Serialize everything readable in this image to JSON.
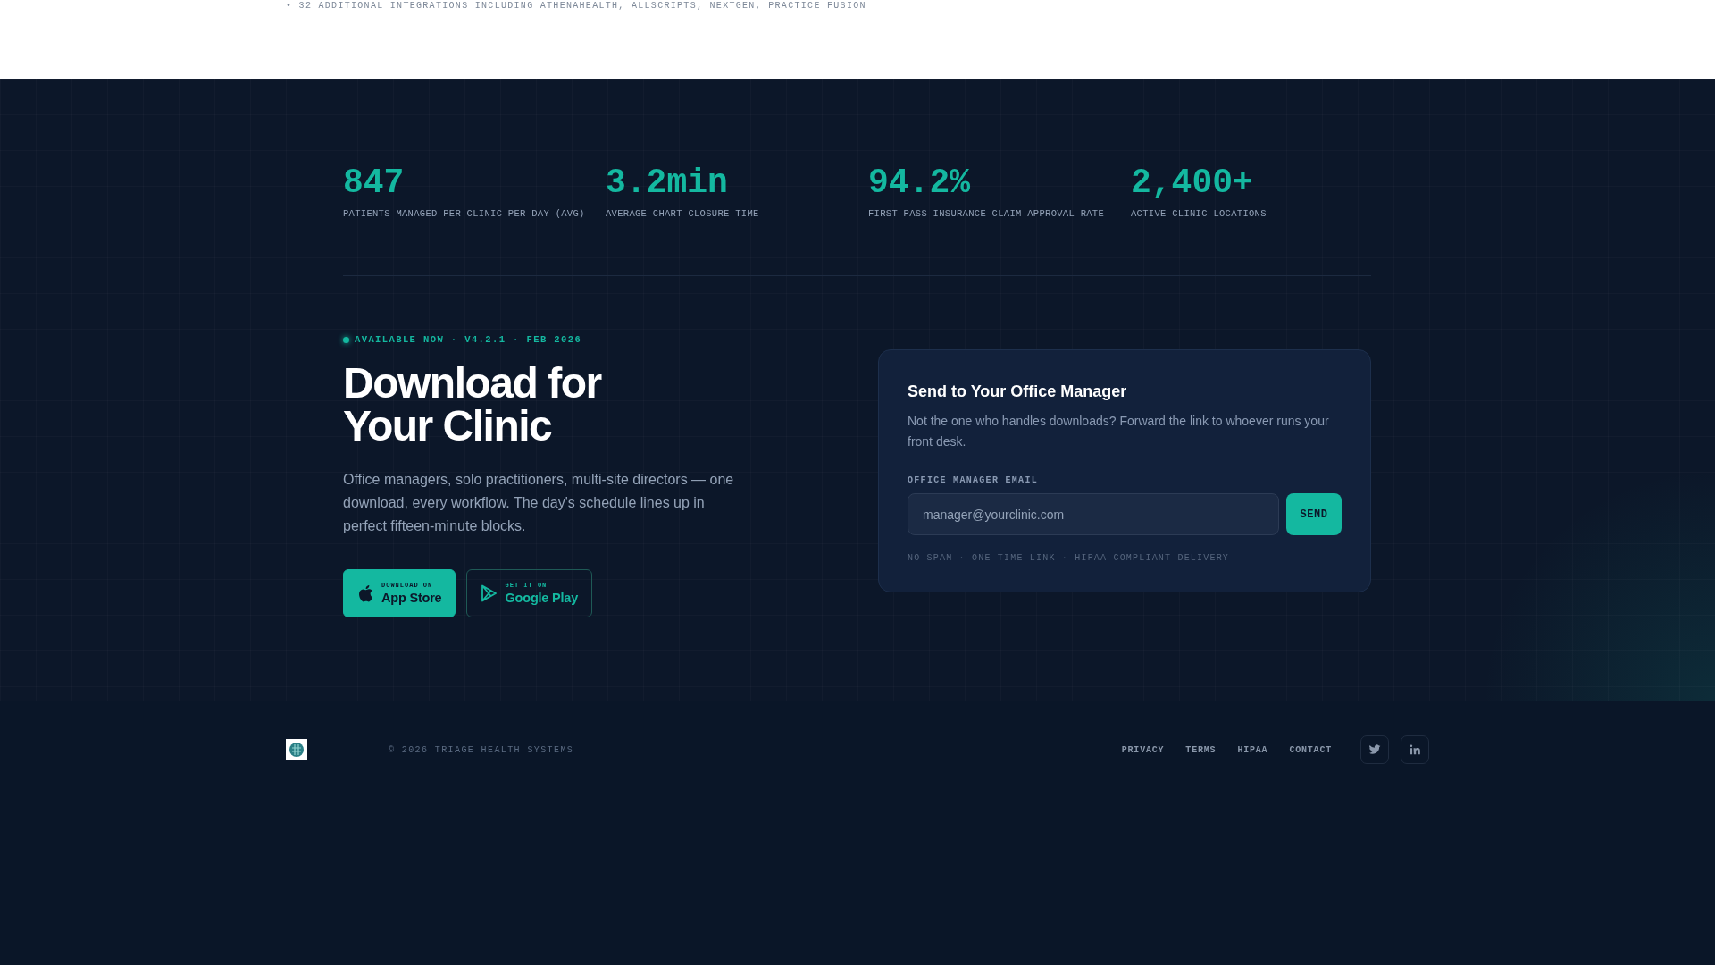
{
  "top_note": "• 32 ADDITIONAL INTEGRATIONS INCLUDING ATHENAHEALTH, ALLSCRIPTS, NEXTGEN, PRACTICE FUSION",
  "stats": [
    {
      "value": "847",
      "label": "PATIENTS MANAGED PER CLINIC PER DAY (AVG)"
    },
    {
      "value": "3.2min",
      "label": "AVERAGE CHART CLOSURE TIME"
    },
    {
      "value": "94.2%",
      "label": "FIRST-PASS INSURANCE CLAIM APPROVAL RATE"
    },
    {
      "value": "2,400+",
      "label": "ACTIVE CLINIC LOCATIONS"
    }
  ],
  "download": {
    "badge": "AVAILABLE NOW · V4.2.1 · FEB 2026",
    "heading": [
      "Download for",
      "Your Clinic"
    ],
    "text": "Office managers, solo practitioners, multi-site directors — one download, every workflow. The day's schedule lines up in perfect fifteen-minute blocks.",
    "stores": [
      {
        "kind": "apple",
        "small": "DOWNLOAD ON",
        "name": "App Store"
      },
      {
        "kind": "google",
        "small": "GET IT ON",
        "name": "Google Play"
      }
    ]
  },
  "send_card": {
    "title": "Send to Your Office Manager",
    "text": "Not the one who handles downloads? Forward the link to whoever runs your front desk.",
    "field_label": "OFFICE MANAGER EMAIL",
    "placeholder": "manager@yourclinic.com",
    "button": "SEND",
    "note": "NO SPAM · ONE-TIME LINK · HIPAA COMPLIANT DELIVERY"
  },
  "footer": {
    "copyright": "© 2026 TRIAGE HEALTH SYSTEMS",
    "links": [
      "PRIVACY",
      "TERMS",
      "HIPAA",
      "CONTACT"
    ],
    "social": [
      {
        "kind": "twitter"
      },
      {
        "kind": "linkedin"
      }
    ]
  }
}
